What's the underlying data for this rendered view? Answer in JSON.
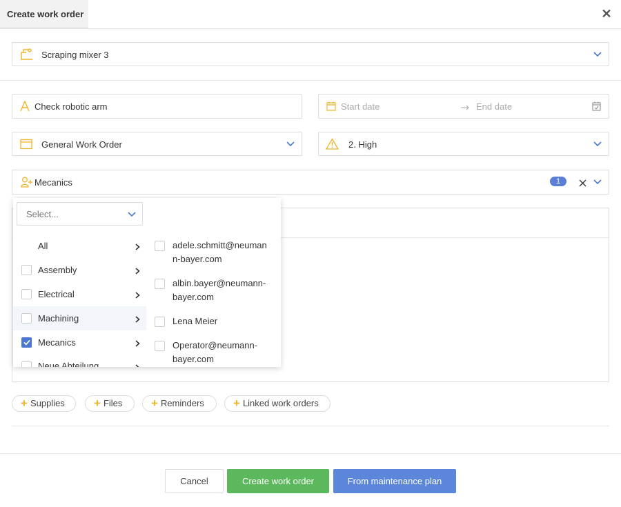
{
  "header": {
    "title": "Create work order"
  },
  "asset": {
    "value": "Scraping mixer 3"
  },
  "title_field": {
    "value": "Check robotic arm"
  },
  "dates": {
    "start_placeholder": "Start date",
    "end_placeholder": "End date"
  },
  "order_type": {
    "value": "General Work Order"
  },
  "priority": {
    "value": "2. High"
  },
  "assignees": {
    "value": "Mecanics",
    "count": "1"
  },
  "popup": {
    "select_placeholder": "Select...",
    "groups": [
      {
        "label": "All",
        "checked": false,
        "has_checkbox": false
      },
      {
        "label": "Assembly",
        "checked": false,
        "has_checkbox": true
      },
      {
        "label": "Electrical",
        "checked": false,
        "has_checkbox": true
      },
      {
        "label": "Machining",
        "checked": false,
        "has_checkbox": true
      },
      {
        "label": "Mecanics",
        "checked": true,
        "has_checkbox": true
      },
      {
        "label": "Neue Abteilung",
        "checked": false,
        "has_checkbox": true
      }
    ],
    "users": [
      {
        "line1": "adele.schmitt@neuman",
        "line2": "n-bayer.com"
      },
      {
        "line1": "albin.bayer@neumann-",
        "line2": "bayer.com"
      },
      {
        "line1": "Lena Meier",
        "line2": ""
      },
      {
        "line1": "Operator@neumann-",
        "line2": "bayer.com"
      }
    ]
  },
  "chips": {
    "supplies": "Supplies",
    "files": "Files",
    "reminders": "Reminders",
    "linked": "Linked work orders"
  },
  "footer": {
    "cancel": "Cancel",
    "create": "Create work order",
    "from_plan": "From maintenance plan"
  },
  "colors": {
    "accent_blue": "#5b86d9",
    "green": "#5cb85c",
    "icon_yellow": "#f0b429",
    "badge_blue": "#5b7fd6"
  }
}
